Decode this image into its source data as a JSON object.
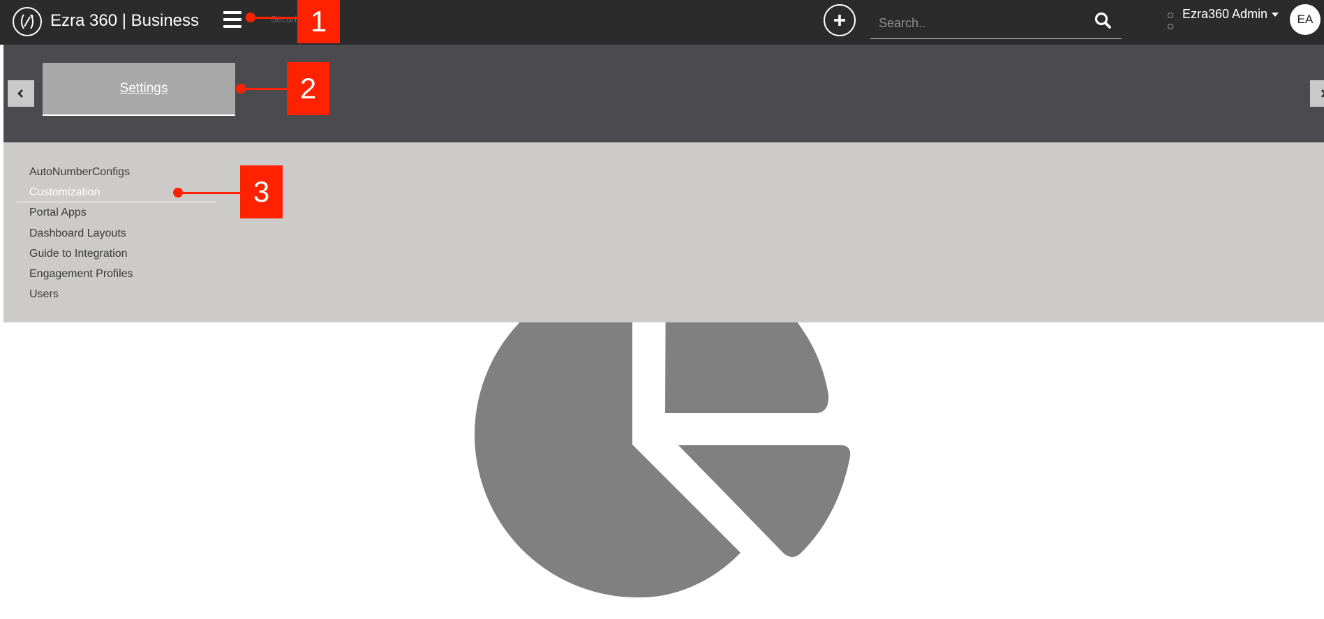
{
  "app": {
    "brand": "Ezra 360",
    "separator": "|",
    "product": "Business",
    "title": "Ezra 360 | Business"
  },
  "header": {
    "sub_hint": "Securi",
    "add_icon": "plus-icon",
    "search": {
      "placeholder": "Search..",
      "value": "",
      "icon": "search-icon"
    },
    "user": {
      "name": "Ezra360 Admin",
      "initials": "EA"
    }
  },
  "tabs": {
    "active_label": "Settings",
    "prev_icon": "chevron-left-icon",
    "next_icon": "chevron-right-icon"
  },
  "settings_menu": {
    "items": [
      {
        "label": "AutoNumberConfigs",
        "active": false
      },
      {
        "label": "Customization",
        "active": true
      },
      {
        "label": "Portal Apps",
        "active": false
      },
      {
        "label": "Dashboard Layouts",
        "active": false
      },
      {
        "label": "Guide to Integration",
        "active": false
      },
      {
        "label": "Engagement Profiles",
        "active": false
      },
      {
        "label": "Users",
        "active": false
      }
    ]
  },
  "background_illustration": {
    "icon": "pie-chart-icon"
  },
  "annotations": [
    {
      "number": "1"
    },
    {
      "number": "2"
    },
    {
      "number": "3"
    }
  ],
  "colors": {
    "topbar": "#2b2b2b",
    "tabbar": "#4a4a4f",
    "menu_panel": "#cccbc9",
    "tab_active": "#a8a8a8",
    "annotation": "#ff2200",
    "illustration": "#808080"
  }
}
